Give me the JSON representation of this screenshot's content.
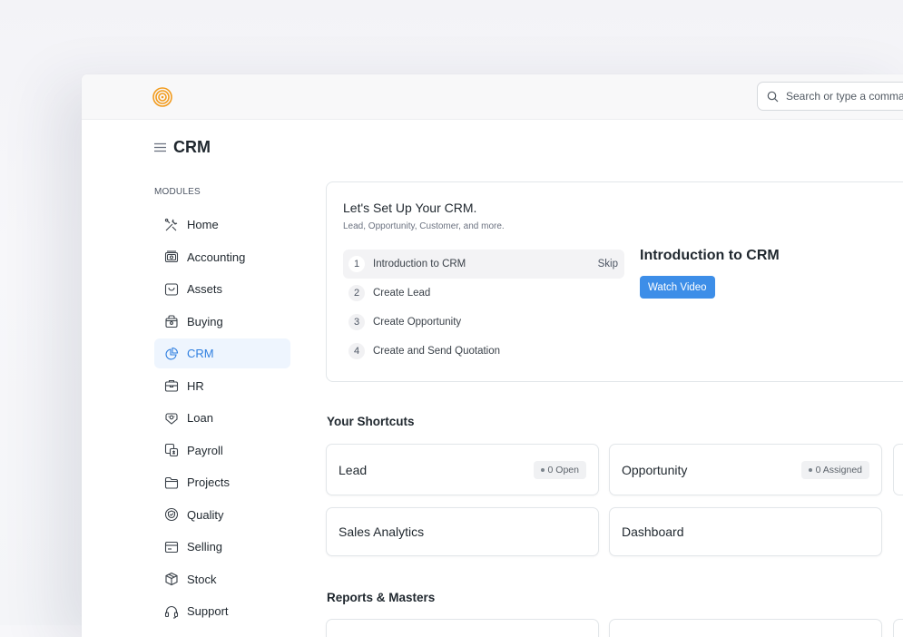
{
  "navbar": {
    "logo": "frappe-logo-icon",
    "search_placeholder": "Search or type a comma"
  },
  "page": {
    "title": "CRM"
  },
  "sidebar": {
    "section_label": "MODULES",
    "items": [
      {
        "label": "Home",
        "icon": "tools-icon"
      },
      {
        "label": "Accounting",
        "icon": "accounting-icon"
      },
      {
        "label": "Assets",
        "icon": "assets-icon"
      },
      {
        "label": "Buying",
        "icon": "buying-icon"
      },
      {
        "label": "CRM",
        "icon": "crm-icon",
        "active": true
      },
      {
        "label": "HR",
        "icon": "hr-icon"
      },
      {
        "label": "Loan",
        "icon": "loan-icon"
      },
      {
        "label": "Payroll",
        "icon": "payroll-icon"
      },
      {
        "label": "Projects",
        "icon": "projects-icon"
      },
      {
        "label": "Quality",
        "icon": "quality-icon"
      },
      {
        "label": "Selling",
        "icon": "selling-icon"
      },
      {
        "label": "Stock",
        "icon": "stock-icon"
      },
      {
        "label": "Support",
        "icon": "support-icon"
      }
    ]
  },
  "onboarding": {
    "title": "Let's Set Up Your CRM.",
    "subtitle": "Lead, Opportunity, Customer, and more.",
    "steps": [
      {
        "num": "1",
        "label": "Introduction to CRM",
        "skip": "Skip",
        "active": true
      },
      {
        "num": "2",
        "label": "Create Lead"
      },
      {
        "num": "3",
        "label": "Create Opportunity"
      },
      {
        "num": "4",
        "label": "Create and Send Quotation"
      }
    ],
    "detail_title": "Introduction to CRM",
    "button_label": "Watch Video",
    "accent": "#3d8ee8"
  },
  "shortcuts": {
    "title": "Your Shortcuts",
    "cards": [
      {
        "label": "Lead",
        "badge": "0 Open"
      },
      {
        "label": "Opportunity",
        "badge": "0 Assigned"
      },
      {
        "label": "Sales Analytics"
      },
      {
        "label": "Dashboard"
      }
    ]
  },
  "reports": {
    "title": "Reports & Masters"
  }
}
